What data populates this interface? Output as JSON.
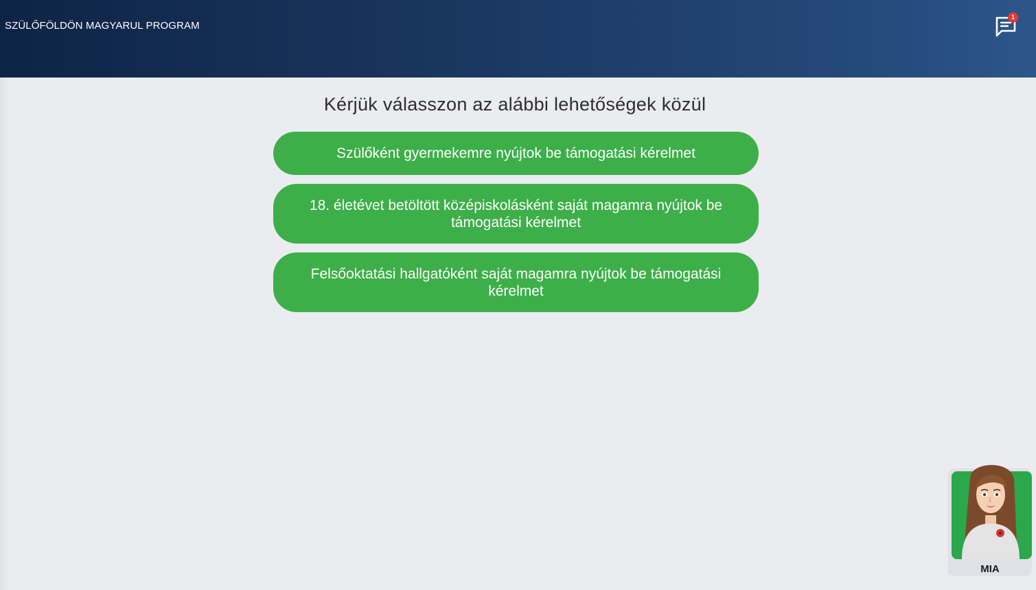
{
  "header": {
    "title": "SZÜLŐFÖLDÖN MAGYARUL PROGRAM",
    "chat_icon": "chat-bubble-icon",
    "chat_badge_count": "1",
    "badge_color": "#e53935"
  },
  "main": {
    "prompt": "Kérjük válasszon az alábbi lehetőségek közül",
    "options": [
      {
        "label": "Szülőként gyermekemre nyújtok be támogatási kérelmet"
      },
      {
        "label": "18. életévet betöltött középiskolásként saját magamra nyújtok be támogatási kérelmet"
      },
      {
        "label": "Felsőoktatási hallgatóként saját magamra nyújtok be támogatási kérelmet"
      }
    ],
    "option_color": "#3daf49"
  },
  "assistant": {
    "name": "MIA",
    "icon": "assistant-avatar-icon",
    "accent": "#2aa84a"
  }
}
